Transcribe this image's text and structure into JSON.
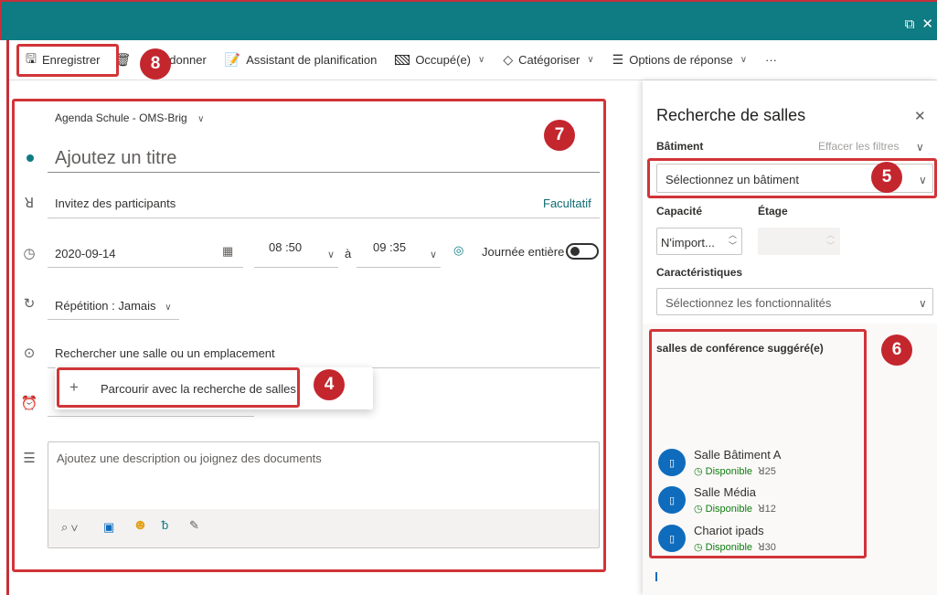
{
  "window": {
    "popout_icon": "popout-icon",
    "close_icon": "close-icon"
  },
  "toolbar": {
    "save_label": "Enregistrer",
    "discard_label": "donner",
    "scheduling_label": "Assistant de planification",
    "busy_label": "Occupé(e)",
    "categorize_label": "Catégoriser",
    "response_label": "Options de réponse",
    "more_label": "···"
  },
  "form": {
    "calendar_name": "Agenda Schule - OMS-Brig",
    "title_placeholder": "Ajoutez un titre",
    "attendees_placeholder": "Invitez des participants",
    "optional_label": "Facultatif",
    "date": "2020-09-14",
    "start_time": "08 :50",
    "to_label": "à",
    "end_time": "09 :35",
    "all_day_label": "Journée entière",
    "repeat_label": "Répétition : Jamais",
    "location_placeholder": "Rechercher une salle ou un emplacement",
    "description_placeholder": "Ajoutez une description ou joignez des documents"
  },
  "location_dropdown": {
    "browse_label": "Parcourir avec la recherche de salles"
  },
  "room_finder": {
    "title": "Recherche de salles",
    "building_label": "Bâtiment",
    "clear_filters": "Effacer les filtres",
    "building_placeholder": "Sélectionnez un bâtiment",
    "capacity_label": "Capacité",
    "floor_label": "Étage",
    "capacity_value": "N'import...",
    "features_label": "Caractéristiques",
    "features_placeholder": "Sélectionnez les fonctionnalités",
    "suggested_heading": "salles de conférence suggéré(e)",
    "rooms": [
      {
        "name": "Salle  Bâtiment A",
        "status": "Disponible",
        "capacity": "25"
      },
      {
        "name": "Salle Média",
        "status": "Disponible",
        "capacity": "12"
      },
      {
        "name": "Chariot ipads",
        "status": "Disponible",
        "capacity": "30"
      }
    ]
  },
  "annotations": {
    "b4": "4",
    "b5": "5",
    "b6": "6",
    "b7": "7",
    "b8": "8"
  },
  "colors": {
    "accent": "#0f7b83",
    "annotation_red": "#d13438",
    "room_blue": "#0f6cbd",
    "available_green": "#107c10"
  }
}
